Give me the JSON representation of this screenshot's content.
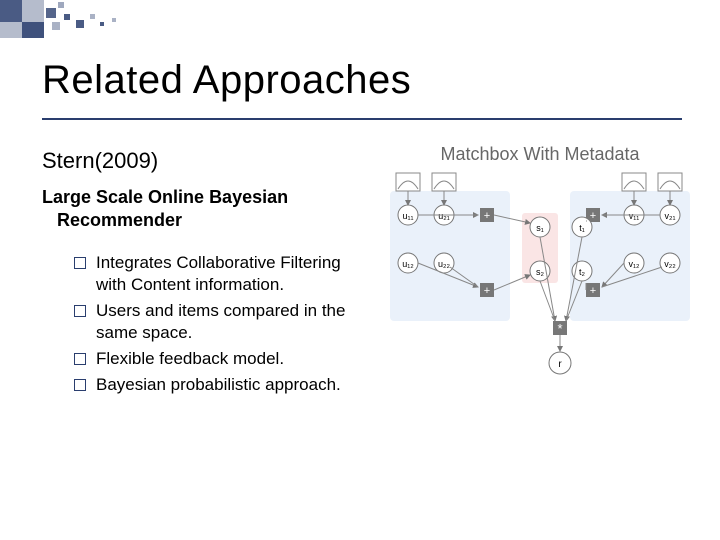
{
  "title": "Related Approaches",
  "citation": "Stern(2009)",
  "subtitle_l1": "Large Scale Online Bayesian",
  "subtitle_l2": "Recommender",
  "bullets": [
    "Integrates Collaborative Filtering with Content information.",
    "Users and items compared in the same space.",
    "Flexible feedback model.",
    "Bayesian probabilistic approach."
  ],
  "diagram": {
    "title": "Matchbox With Metadata",
    "nodes": {
      "u11": "u₁₁",
      "u21": "u₂₁",
      "u12": "u₁₂",
      "u22": "u₂₂",
      "s1": "s₁",
      "s2": "s₂",
      "t1": "t₁",
      "t2": "t₂",
      "v11": "v₁₁",
      "v21": "v₂₁",
      "v12": "v₁₂",
      "v22": "v₂₂",
      "plus": "+",
      "star": "*",
      "r": "r"
    }
  }
}
